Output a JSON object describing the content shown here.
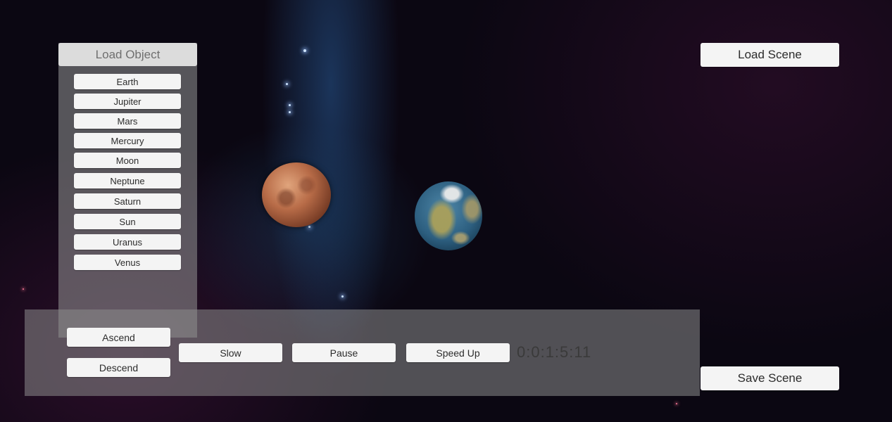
{
  "load_object": {
    "header": "Load Object",
    "items": [
      "Earth",
      "Jupiter",
      "Mars",
      "Mercury",
      "Moon",
      "Neptune",
      "Saturn",
      "Sun",
      "Uranus",
      "Venus"
    ]
  },
  "scene": {
    "load_label": "Load Scene",
    "save_label": "Save Scene"
  },
  "controls": {
    "ascend_label": "Ascend",
    "descend_label": "Descend",
    "slow_label": "Slow",
    "pause_label": "Pause",
    "speedup_label": "Speed Up",
    "timer": "0:0:1:5:11"
  },
  "viewport": {
    "planets": [
      "mars",
      "earth"
    ]
  }
}
